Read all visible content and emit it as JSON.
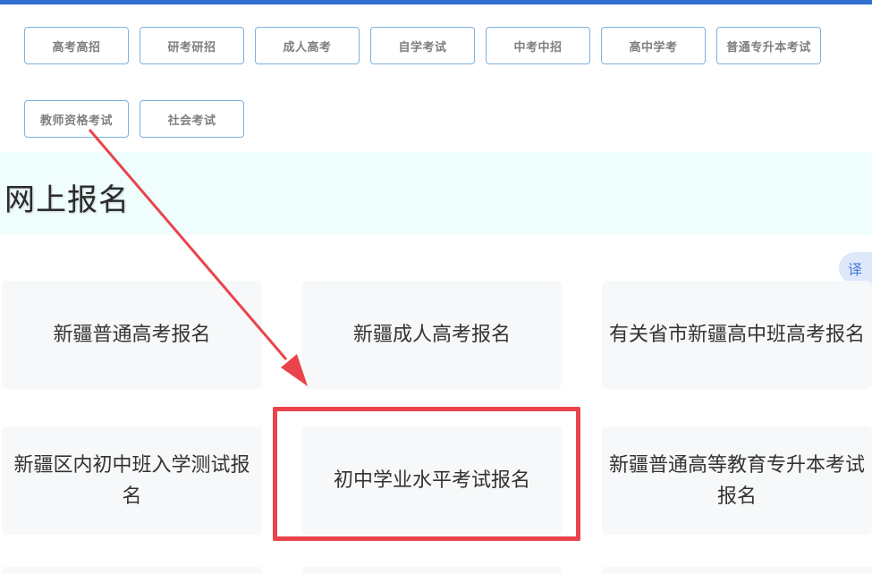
{
  "tabs": [
    {
      "label": "高考高招"
    },
    {
      "label": "研考研招"
    },
    {
      "label": "成人高考"
    },
    {
      "label": "自学考试"
    },
    {
      "label": "中考中招"
    },
    {
      "label": "高中学考"
    },
    {
      "label": "普通专升本考试"
    },
    {
      "label": "教师资格考试"
    },
    {
      "label": "社会考试"
    }
  ],
  "section": {
    "title": "网上报名"
  },
  "cards": [
    {
      "label": "新疆普通高考报名"
    },
    {
      "label": "新疆成人高考报名"
    },
    {
      "label": "有关省市新疆高中班高考报名"
    },
    {
      "label": "新疆区内初中班入学测试报名"
    },
    {
      "label": "初中学业水平考试报名"
    },
    {
      "label": "新疆普通高等教育专升本考试报名"
    }
  ],
  "translate": {
    "label": "译"
  },
  "colors": {
    "accent": "#2f6fcf",
    "highlight": "#e9444b",
    "tab_border": "#7eb1dd",
    "band": "#f0fdfd",
    "card_bg": "#f6f8f9"
  }
}
